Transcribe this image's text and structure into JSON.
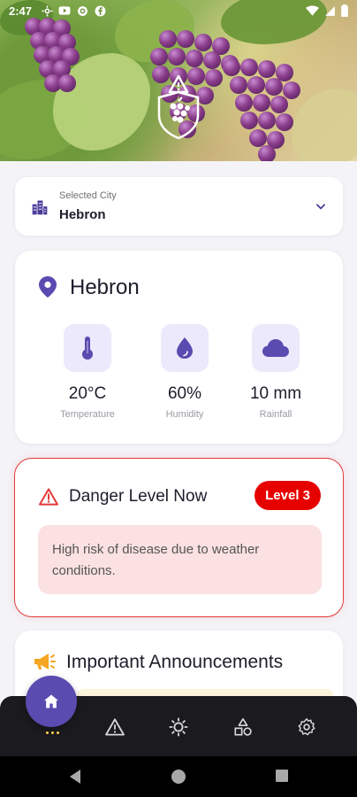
{
  "status_bar": {
    "time": "2:47",
    "icons": [
      "gear-icon",
      "youtube-icon",
      "at-icon",
      "facebook-icon"
    ],
    "right_icons": [
      "wifi-icon",
      "signal-icon",
      "battery-icon"
    ]
  },
  "hero": {
    "image": "grapes-vineyard",
    "overlay_icon": "grape-shield-warning-icon"
  },
  "city_selector": {
    "caption": "Selected City",
    "value": "Hebron",
    "icon": "buildings-icon",
    "chevron": "chevron-down-icon"
  },
  "weather": {
    "city": "Hebron",
    "metrics": [
      {
        "value": "20°C",
        "label": "Temperature",
        "icon": "thermometer-icon"
      },
      {
        "value": "60%",
        "label": "Humidity",
        "icon": "droplet-icon"
      },
      {
        "value": "10 mm",
        "label": "Rainfall",
        "icon": "cloud-icon"
      }
    ]
  },
  "danger": {
    "title": "Danger Level Now",
    "level": "Level 3",
    "message": "High risk of disease due to weather conditions.",
    "accent_color": "#e60000"
  },
  "announcements": {
    "title": "Important Announcements",
    "icon": "megaphone-icon"
  },
  "bottom_nav": {
    "items": [
      "home-icon",
      "warning-icon",
      "sun-icon",
      "shapes-icon",
      "settings-icon"
    ],
    "active": "home-icon"
  },
  "colors": {
    "primary": "#5a4bb0",
    "icon_bg": "#ebe9fb",
    "danger": "#e23b3b"
  }
}
